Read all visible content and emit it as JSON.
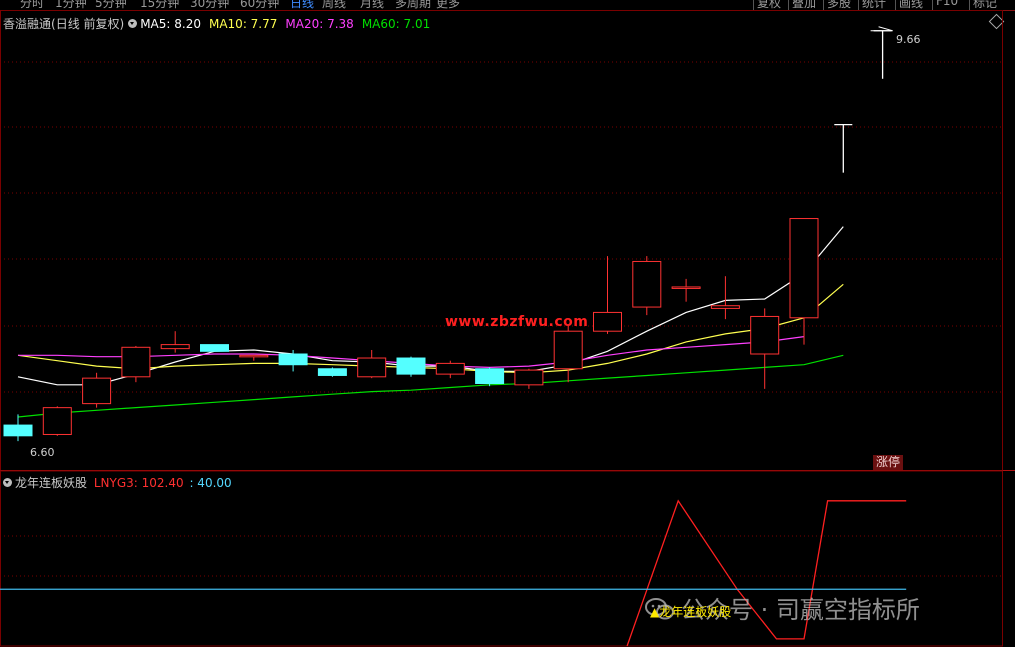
{
  "tabs": {
    "items": [
      "分时",
      "1分钟",
      "5分钟",
      "15分钟",
      "30分钟",
      "60分钟",
      "日线",
      "周线",
      "月线",
      "多周期",
      "更多"
    ],
    "active": "日线"
  },
  "right_tabs": [
    "复权",
    "叠加",
    "多股",
    "统计",
    "画线",
    "F10",
    "标记"
  ],
  "main": {
    "stock_name": "香溢融通",
    "period_label": "(日线 前复权)",
    "ma5_label": "MA5: 8.20",
    "ma10_label": "MA10: 7.77",
    "ma20_label": "MA20: 7.38",
    "ma60_label": "MA60: 7.01",
    "high_label": "9.66",
    "low_label": "6.60",
    "badge": "涨停"
  },
  "sub": {
    "indicator_name": "龙年连板妖股",
    "value_label": "LNYG3: 102.40",
    "value2_label": ": 40.00",
    "signal_label": "龙年连板妖股"
  },
  "watermark": "www.zbzfwu.com",
  "wechat_text": "公众号 · 司赢空指标所",
  "colors": {
    "up": "#ff3232",
    "down": "#54ffff",
    "ma5": "#ffffff",
    "ma10": "#ffff50",
    "ma20": "#ff40ff",
    "ma60": "#00e000",
    "grid": "#7a0000",
    "lnyg3": "#ff2020",
    "level": "#3fb8e8"
  },
  "chart_data": [
    {
      "type": "candlestick",
      "title": "香溢融通 (日线 前复权)",
      "ylim": [
        6.4,
        9.8
      ],
      "candles": [
        {
          "o": 6.72,
          "h": 6.8,
          "l": 6.6,
          "c": 6.64
        },
        {
          "o": 6.65,
          "h": 6.86,
          "l": 6.64,
          "c": 6.85
        },
        {
          "o": 6.88,
          "h": 7.11,
          "l": 6.85,
          "c": 7.07
        },
        {
          "o": 7.08,
          "h": 7.31,
          "l": 7.04,
          "c": 7.3
        },
        {
          "o": 7.29,
          "h": 7.42,
          "l": 7.26,
          "c": 7.32
        },
        {
          "o": 7.32,
          "h": 7.32,
          "l": 7.27,
          "c": 7.27
        },
        {
          "o": 7.23,
          "h": 7.24,
          "l": 7.2,
          "c": 7.24
        },
        {
          "o": 7.25,
          "h": 7.28,
          "l": 7.12,
          "c": 7.17
        },
        {
          "o": 7.14,
          "h": 7.15,
          "l": 7.08,
          "c": 7.09
        },
        {
          "o": 7.08,
          "h": 7.28,
          "l": 7.07,
          "c": 7.22
        },
        {
          "o": 7.22,
          "h": 7.23,
          "l": 7.08,
          "c": 7.1
        },
        {
          "o": 7.1,
          "h": 7.2,
          "l": 7.07,
          "c": 7.18
        },
        {
          "o": 7.14,
          "h": 7.15,
          "l": 7.01,
          "c": 7.03
        },
        {
          "o": 7.02,
          "h": 7.14,
          "l": 6.99,
          "c": 7.13
        },
        {
          "o": 7.14,
          "h": 7.46,
          "l": 7.04,
          "c": 7.42
        },
        {
          "o": 7.42,
          "h": 7.98,
          "l": 7.4,
          "c": 7.56
        },
        {
          "o": 7.6,
          "h": 7.98,
          "l": 7.54,
          "c": 7.94
        },
        {
          "o": 7.74,
          "h": 7.81,
          "l": 7.64,
          "c": 7.75
        },
        {
          "o": 7.59,
          "h": 7.83,
          "l": 7.51,
          "c": 7.61
        },
        {
          "o": 7.25,
          "h": 7.59,
          "l": 6.99,
          "c": 7.53
        },
        {
          "o": 7.52,
          "h": 7.52,
          "l": 7.32,
          "c": 8.26
        },
        {
          "o": 8.96,
          "h": 9.1,
          "l": 8.96,
          "c": 8.96
        },
        {
          "o": 9.66,
          "h": 9.66,
          "l": 9.66,
          "c": 9.66
        }
      ],
      "series": [
        {
          "name": "MA5",
          "values": [
            7.08,
            7.02,
            7.02,
            7.1,
            7.19,
            7.27,
            7.28,
            7.25,
            7.2,
            7.19,
            7.16,
            7.16,
            7.12,
            7.12,
            7.17,
            7.27,
            7.42,
            7.56,
            7.65,
            7.66,
            7.85,
            8.2,
            null
          ]
        },
        {
          "name": "MA10",
          "values": [
            7.24,
            7.2,
            7.16,
            7.14,
            7.16,
            7.17,
            7.18,
            7.18,
            7.17,
            7.16,
            7.15,
            7.14,
            7.12,
            7.11,
            7.13,
            7.18,
            7.25,
            7.34,
            7.4,
            7.44,
            7.52,
            7.77,
            null
          ]
        },
        {
          "name": "MA20",
          "values": [
            7.24,
            7.24,
            7.23,
            7.23,
            7.24,
            7.25,
            7.25,
            7.24,
            7.22,
            7.2,
            7.18,
            7.16,
            7.15,
            7.16,
            7.19,
            7.24,
            7.28,
            7.3,
            7.32,
            7.34,
            7.38,
            null,
            null
          ]
        },
        {
          "name": "MA60",
          "values": [
            6.78,
            6.81,
            6.83,
            6.85,
            6.87,
            6.89,
            6.91,
            6.93,
            6.95,
            6.97,
            6.98,
            7.0,
            7.02,
            7.03,
            7.05,
            7.07,
            7.09,
            7.11,
            7.13,
            7.15,
            7.17,
            7.24,
            null
          ]
        }
      ]
    },
    {
      "type": "line",
      "title": "龙年连板妖股",
      "ylim": [
        0,
        110
      ],
      "series": [
        {
          "name": "LNYG3",
          "values": [
            {
              "x": 15.5,
              "y": 0
            },
            {
              "x": 16.8,
              "y": 102.4
            },
            {
              "x": 18.3,
              "y": 40
            },
            {
              "x": 19.3,
              "y": 5
            },
            {
              "x": 20.0,
              "y": 5
            },
            {
              "x": 20.6,
              "y": 102.4
            },
            {
              "x": 22.6,
              "y": 102.4
            }
          ]
        },
        {
          "name": "40.00",
          "values": [
            {
              "x": -0.5,
              "y": 40
            },
            {
              "x": 22.6,
              "y": 40
            }
          ]
        }
      ]
    }
  ]
}
